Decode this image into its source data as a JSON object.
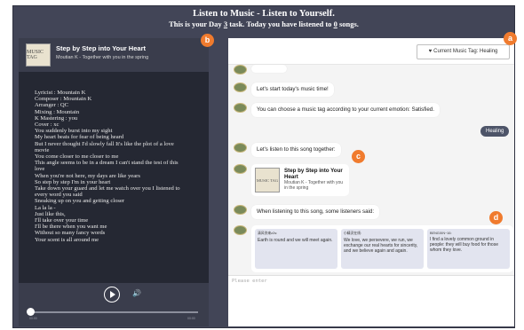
{
  "header": {
    "title": "Listen to Music - Listen to Yourself.",
    "line2_prefix": "This is your Day ",
    "day": "3",
    "line2_mid": " task. Today you have listened to ",
    "count": "0",
    "line2_suffix": " songs."
  },
  "badges": {
    "a": "a",
    "b": "b",
    "c": "c",
    "d": "d"
  },
  "player": {
    "cover_text": "MUSIC TAG",
    "title": "Step by Step into Your Heart",
    "subtitle": "Moutian K - Together with you in the spring",
    "lyrics": [
      "Lyricist : Mountain K",
      "Composer : Mountain K",
      "Arranger : QC",
      "Mixing : Mountain",
      "K Mastering : you",
      "Cover : xc",
      "You suddenly burst into my sight",
      "My heart beats for fear of being heard",
      "But I never thought I'd slowly fall It's like the plot of a love",
      "movie",
      "You come closer to me closer to me",
      "This angle seems to be in a dream I can't stand the test of this",
      "love",
      "When you're not here, my days are like years",
      "So step by step I'm in your heart",
      "Take down your guard and let me watch over you I listened to",
      "every word you said",
      "Sneaking up on you and getting closer",
      "La la la -",
      "Just like this,",
      "I'll take over your time",
      "I'll be there when you want me",
      "Without so many fancy words",
      "Your scent is all around me"
    ],
    "time_start": "00:00",
    "time_end": "00:00"
  },
  "tag_button": {
    "icon": "heart-icon",
    "label": "Current Music Tag: Healing"
  },
  "chat": {
    "m1": "Let's start today's music time!",
    "m2": "You can choose a music tag according to your current emotion: Satisfied.",
    "user_reply": "Healing",
    "m3": "Let's listen to this song together:",
    "card": {
      "cover_text": "MUSIC TAG",
      "title": "Step by Step into Your Heart",
      "subtitle": "Moutian K - Together with you in the spring"
    },
    "m4": "When listening to this song, some listeners said:",
    "comments": [
      {
        "name": "清风徐来z2s:",
        "text": "Earth is round and we will meet again."
      },
      {
        "name": "小精灵在线:",
        "text": "We love, we persevere, we run, we exchange our real hearts for sincerity, and we believe again and again."
      },
      {
        "name": "BENGXIN~16:",
        "text": "I find a lovely common ground in people: they will buy food for those whom they love."
      }
    ]
  },
  "input": {
    "placeholder": "Please enter"
  },
  "colors": {
    "frame": "#424557",
    "badge": "#f07b2e",
    "user_bubble": "#4d5468",
    "comment_card": "#e2e4ef"
  }
}
